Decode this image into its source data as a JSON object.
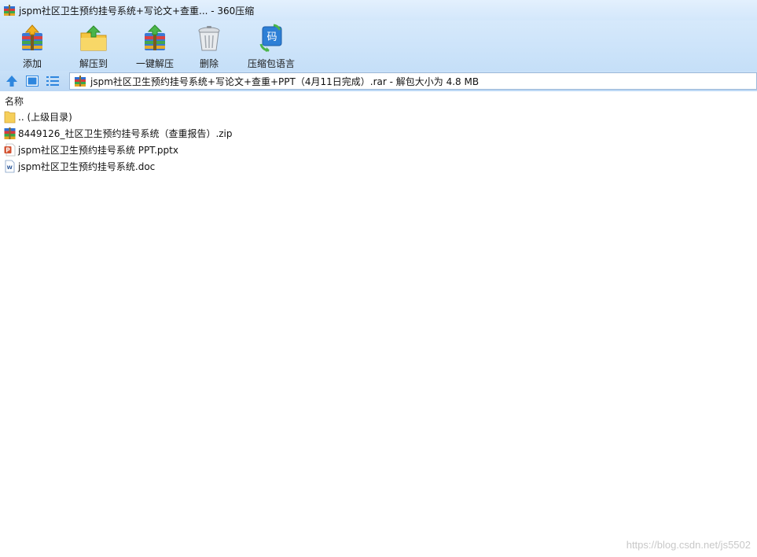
{
  "window": {
    "title": "jspm社区卫生预约挂号系统+写论文+查重... - 360压缩"
  },
  "toolbar": {
    "buttons": [
      {
        "label": "添加",
        "icon": "add-archive-icon"
      },
      {
        "label": "解压到",
        "icon": "extract-to-icon"
      },
      {
        "label": "一键解压",
        "icon": "one-click-extract-icon"
      },
      {
        "label": "删除",
        "icon": "delete-icon"
      },
      {
        "label": "压缩包语言",
        "icon": "archive-language-icon"
      }
    ]
  },
  "navbar": {
    "address": "jspm社区卫生预约挂号系统+写论文+查重+PPT（4月11日完成）.rar - 解包大小为 4.8 MB"
  },
  "list": {
    "header_name": "名称",
    "items": [
      {
        "name": ".. (上级目录)",
        "icon": "folder-icon"
      },
      {
        "name": "8449126_社区卫生预约挂号系统（查重报告）.zip",
        "icon": "zip-archive-icon"
      },
      {
        "name": "jspm社区卫生预约挂号系统 PPT.pptx",
        "icon": "pptx-file-icon"
      },
      {
        "name": "jspm社区卫生预约挂号系统.doc",
        "icon": "doc-file-icon"
      }
    ]
  },
  "watermark": "https://blog.csdn.net/js5502",
  "colors": {
    "toolbar_bg": "#c5dff8",
    "titlebar_bg": "#d3e7fb",
    "accent_blue": "#2d7fd6"
  }
}
